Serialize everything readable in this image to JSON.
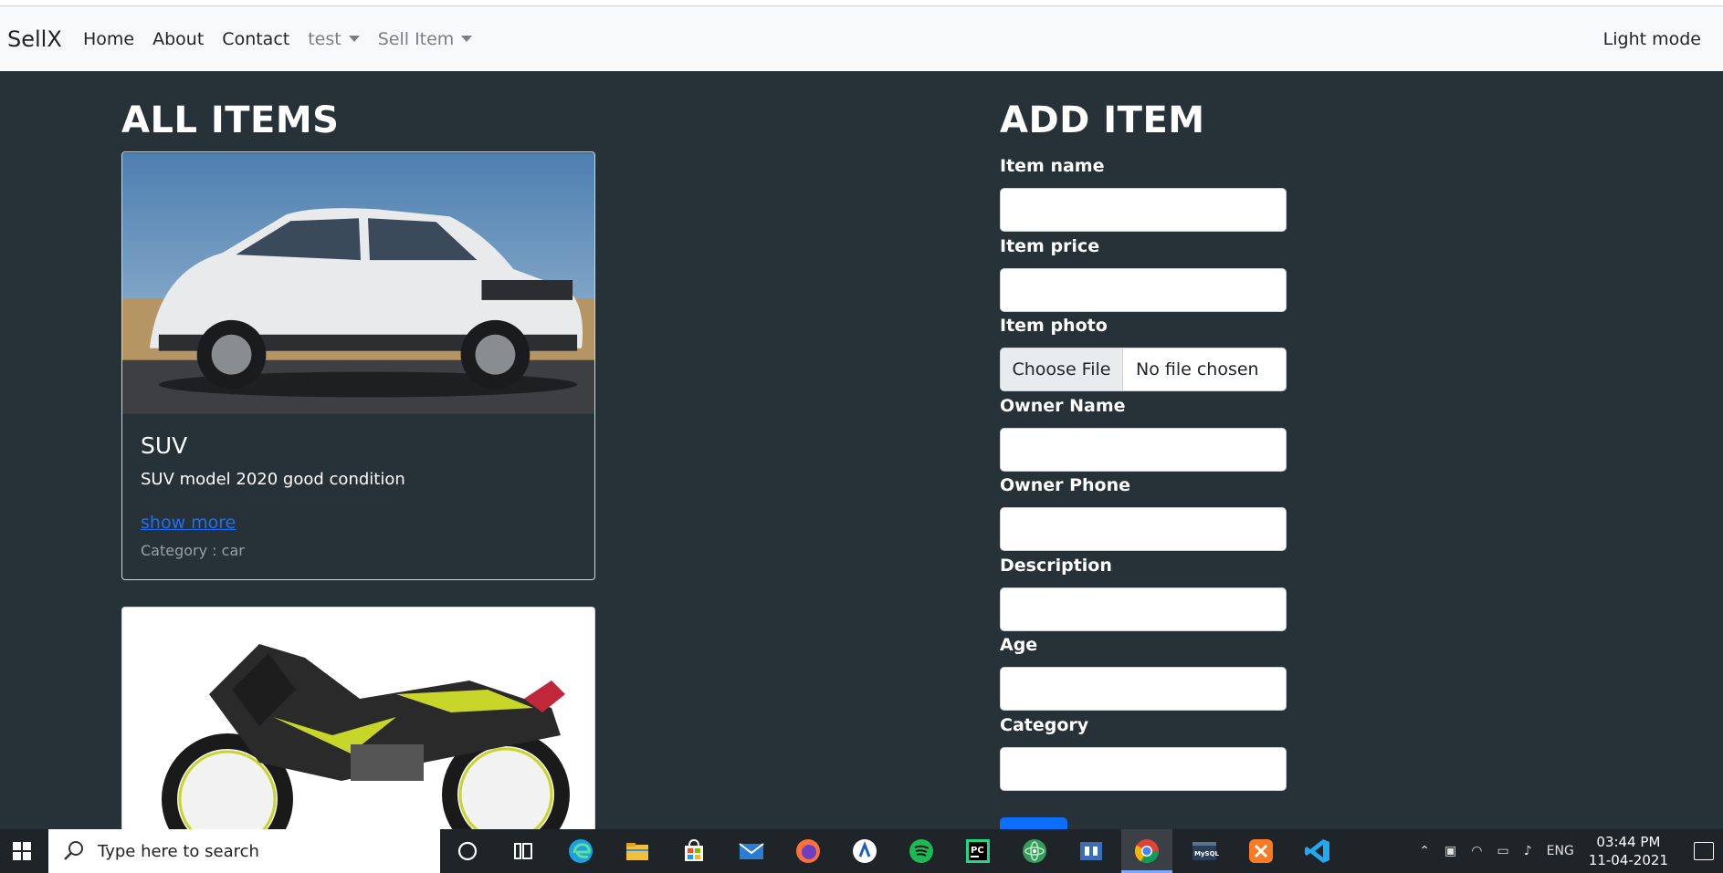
{
  "navbar": {
    "brand": "SellX",
    "links": [
      "Home",
      "About",
      "Contact"
    ],
    "dropdowns": [
      "test",
      "Sell Item"
    ],
    "mode_toggle": "Light mode"
  },
  "all_items": {
    "title": "ALL ITEMS",
    "cards": [
      {
        "title": "SUV",
        "text": "SUV model 2020 good condition",
        "link": "show more",
        "category": "Category : car"
      }
    ]
  },
  "add_item": {
    "title": "ADD ITEM",
    "fields": {
      "item_name": "Item name",
      "item_price": "Item price",
      "item_photo": "Item photo",
      "owner_name": "Owner Name",
      "owner_phone": "Owner Phone",
      "description": "Description",
      "age": "Age",
      "category": "Category"
    },
    "file_button": "Choose File",
    "file_status": "No file chosen"
  },
  "taskbar": {
    "search_placeholder": "Type here to search",
    "language": "ENG",
    "time": "03:44 PM",
    "date": "11-04-2021",
    "colors": {
      "edge": "#1ba1e2",
      "spotify": "#1db954",
      "vscode": "#23a9f2",
      "xampp": "#fb7a24",
      "chrome": "#4285f4"
    }
  }
}
